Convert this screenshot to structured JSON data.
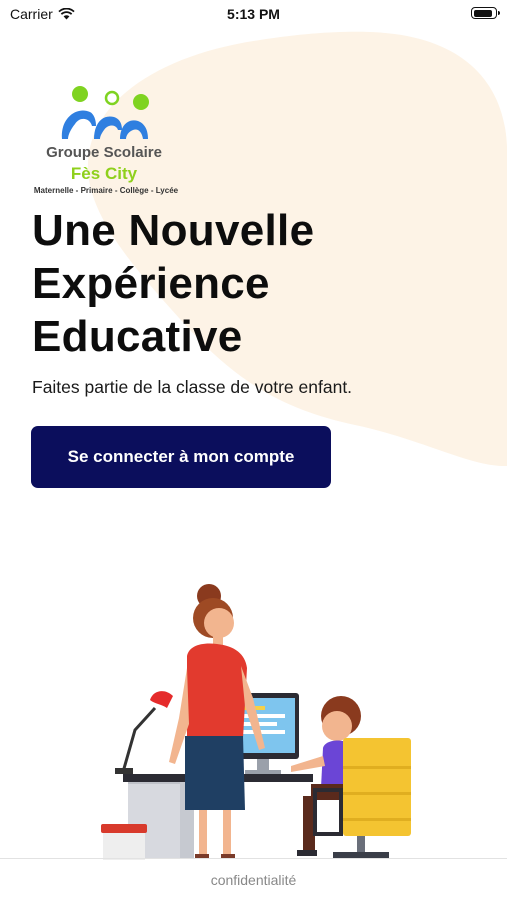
{
  "status_bar": {
    "carrier": "Carrier",
    "time": "5:13 PM",
    "battery_level": 0.9
  },
  "logo": {
    "line1": "Groupe Scolaire",
    "line2": "Fès City",
    "line3": "Maternelle - Primaire - Collège - Lycée"
  },
  "hero": {
    "title_lines": [
      "Une Nouvelle",
      "Expérience",
      "Educative"
    ],
    "subtitle": "Faites partie de la classe de votre enfant."
  },
  "login_button": {
    "label": "Se connecter à mon compte"
  },
  "footer": {
    "privacy_link": "confidentialité"
  },
  "colors": {
    "primary": "#0b0e5c",
    "logo_blue": "#2f7fe0",
    "logo_green": "#7fd321",
    "background_blob": "#fdf3e6"
  },
  "icons": {
    "wifi": "wifi-icon",
    "battery": "battery-icon",
    "illustration": "teacher-student-computer-illustration"
  }
}
